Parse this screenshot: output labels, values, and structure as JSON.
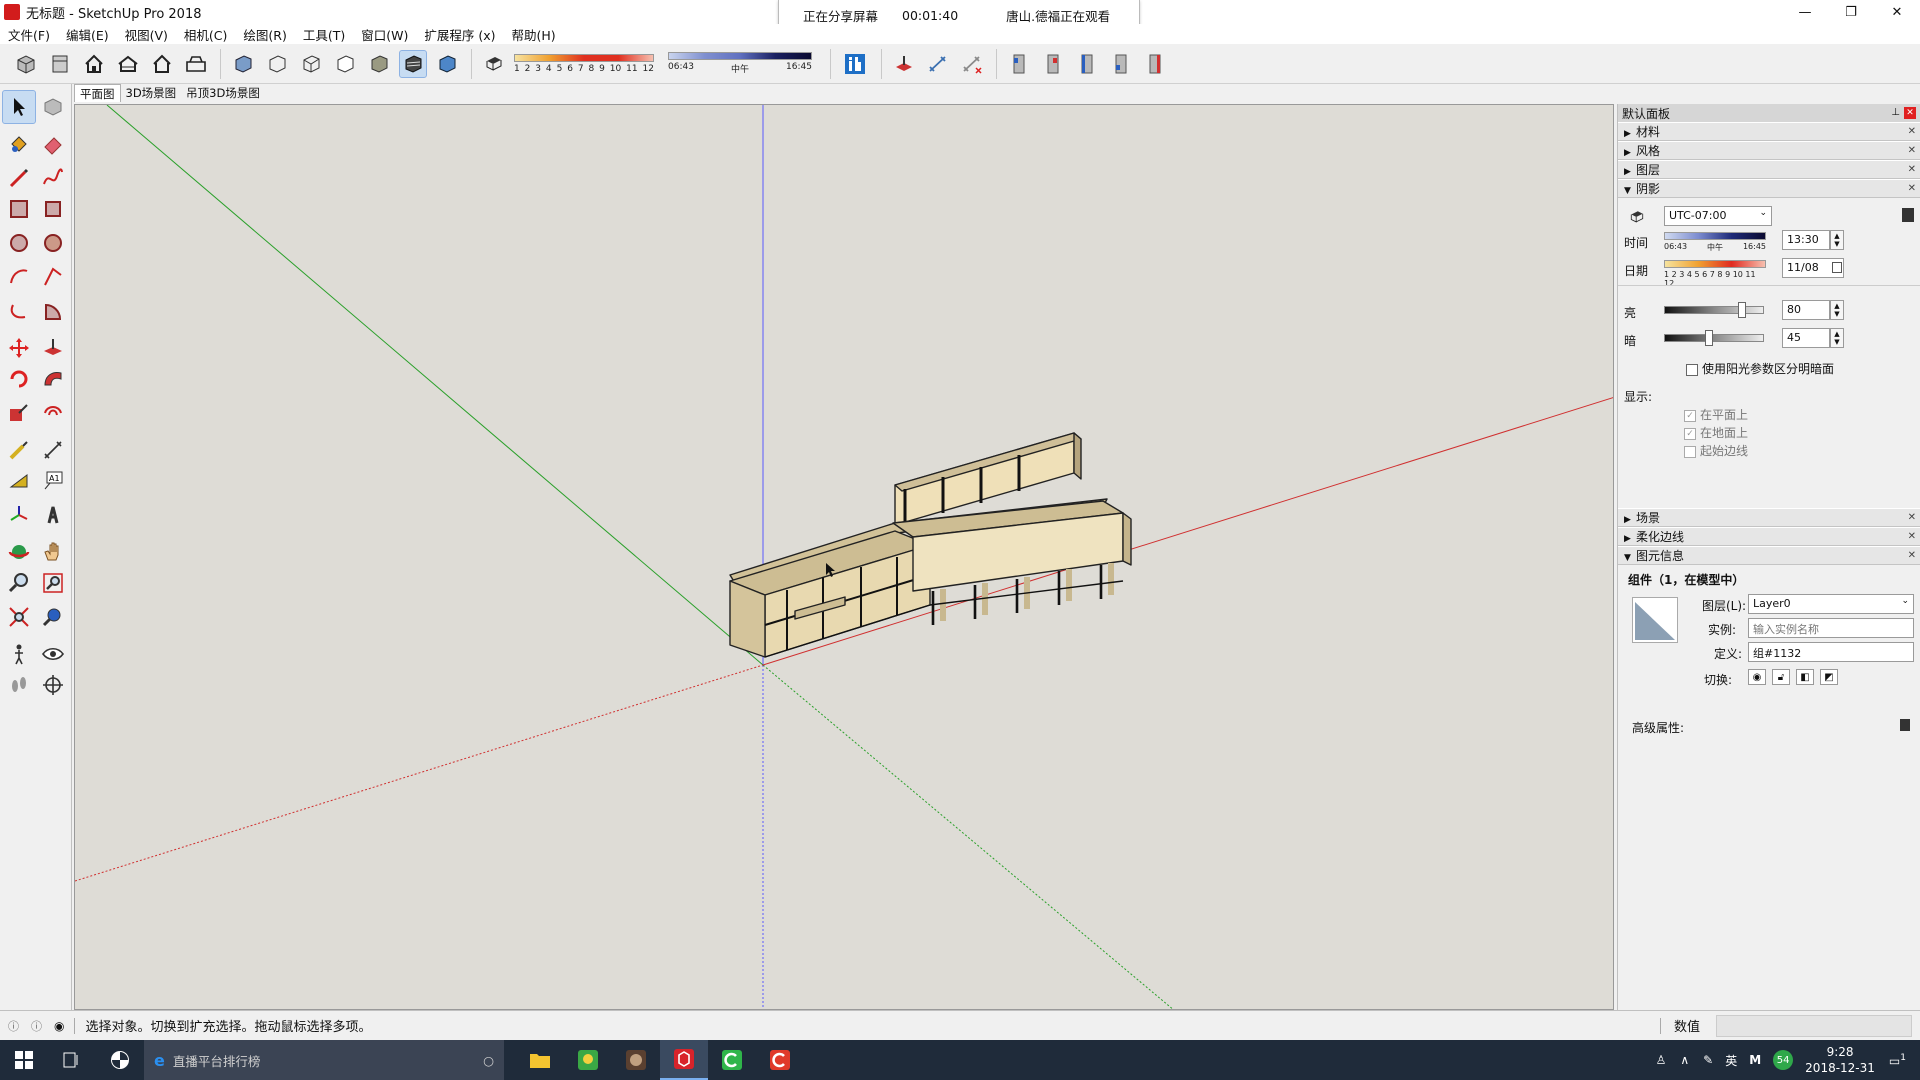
{
  "window": {
    "title": "无标题 - SketchUp Pro 2018",
    "controls": [
      "—",
      "❐",
      "✕"
    ]
  },
  "share_banner": {
    "status": "正在分享屏幕",
    "timer": "00:01:40",
    "viewer": "唐山.德福正在观看"
  },
  "menu": [
    "文件(F)",
    "编辑(E)",
    "视图(V)",
    "相机(C)",
    "绘图(R)",
    "工具(T)",
    "窗口(W)",
    "扩展程序 (x)",
    "帮助(H)"
  ],
  "toolbar": {
    "date_ticks": [
      "1",
      "2",
      "3",
      "4",
      "5",
      "6",
      "7",
      "8",
      "9",
      "10",
      "11",
      "12"
    ],
    "time_start": "06:43",
    "time_mid": "中午",
    "time_end": "16:45"
  },
  "scene_tabs": [
    "平面图",
    "3D场景图",
    "吊顶3D场景图"
  ],
  "panel": {
    "title": "默认面板",
    "trays_top": [
      "材料",
      "风格",
      "图层",
      "阴影"
    ],
    "shadow": {
      "timezone": "UTC-07:00",
      "time_label": "时间",
      "time_value": "13:30",
      "time_start": "06:43",
      "time_mid": "中午",
      "time_end": "16:45",
      "date_label": "日期",
      "date_value": "11/08",
      "date_ticks": "1 2 3 4 5 6 7 8 9 10 11 12",
      "light_label": "亮",
      "light_value": "80",
      "light_level": 0.8,
      "dark_label": "暗",
      "dark_value": "45",
      "dark_level": 0.45,
      "use_sun_label": "使用阳光参数区分明暗面",
      "display_label": "显示:",
      "on_faces": "在平面上",
      "on_ground": "在地面上",
      "from_edges": "起始边线"
    },
    "trays_bottom": [
      "场景",
      "柔化边线",
      "图元信息"
    ],
    "entity": {
      "heading": "组件（1，在模型中）",
      "layer_label": "图层(L):",
      "layer_value": "Layer0",
      "instance_label": "实例:",
      "instance_placeholder": "输入实例名称",
      "definition_label": "定义:",
      "definition_value": "组#1132",
      "toggle_label": "切换:",
      "advanced_label": "高级属性:"
    }
  },
  "status": {
    "hint": "选择对象。切换到扩充选择。拖动鼠标选择多项。",
    "measure_label": "数值"
  },
  "taskbar": {
    "search_placeholder": "直播平台排行榜",
    "ime_lang": "英",
    "ime_mode": "M",
    "badge": "54",
    "time": "9:28",
    "date": "2018-12-31",
    "notif_count": "1"
  }
}
